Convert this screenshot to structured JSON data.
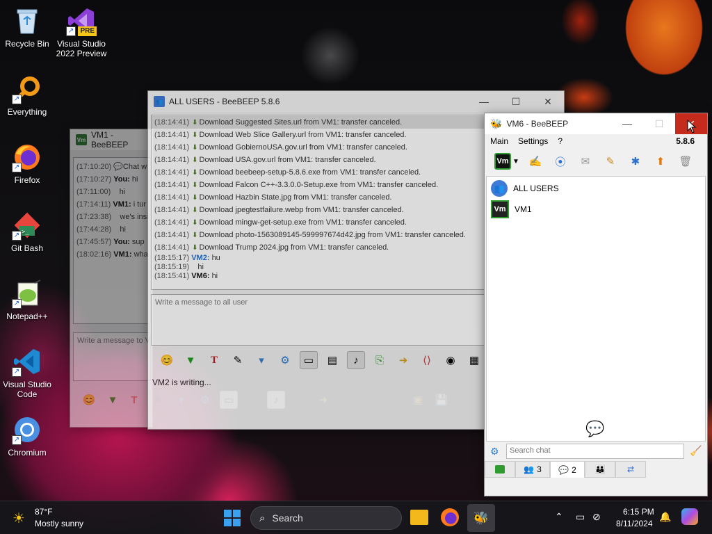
{
  "desktop": {
    "icons": [
      {
        "label": "Recycle Bin"
      },
      {
        "label": "Visual Studio 2022 Preview",
        "badge": "PRE"
      },
      {
        "label": "Everything"
      },
      {
        "label": "Firefox"
      },
      {
        "label": "Git Bash"
      },
      {
        "label": "Notepad++"
      },
      {
        "label": "Visual Studio Code"
      },
      {
        "label": "Chromium"
      }
    ]
  },
  "vm1_window": {
    "icon_text": "Vm",
    "title": "VM1 - BeeBEEP",
    "lines": [
      {
        "ts": "(17:10:20)",
        "name": "",
        "text": "Chat w"
      },
      {
        "ts": "(17:10:27)",
        "name": "You:",
        "text": "hi"
      },
      {
        "ts": "(17:11:00)",
        "name": "",
        "text": "hi"
      },
      {
        "ts": "(17:14:11)",
        "name": "VM1:",
        "text": "i tur"
      },
      {
        "ts": "(17:23:38)",
        "name": "",
        "text": "we's insi"
      },
      {
        "ts": "(17:44:28)",
        "name": "",
        "text": "hi"
      },
      {
        "ts": "(17:45:57)",
        "name": "You:",
        "text": "sup"
      },
      {
        "ts": "(18:02:16)",
        "name": "VM1:",
        "text": "wha"
      }
    ],
    "input_placeholder": "Write a message to VM"
  },
  "all_users_window": {
    "title": "ALL USERS - BeeBEEP 5.8.6",
    "log": [
      {
        "ts": "(18:14:41)",
        "text": "Download Suggested Sites.url from VM1: transfer canceled."
      },
      {
        "ts": "(18:14:41)",
        "text": "Download Web Slice Gallery.url from VM1: transfer canceled."
      },
      {
        "ts": "(18:14:41)",
        "text": "Download GobiernoUSA.gov.url from VM1: transfer canceled."
      },
      {
        "ts": "(18:14:41)",
        "text": "Download USA.gov.url from VM1: transfer canceled."
      },
      {
        "ts": "(18:14:41)",
        "text": "Download beebeep-setup-5.8.6.exe from VM1: transfer canceled."
      },
      {
        "ts": "(18:14:41)",
        "text": "Download Falcon C++-3.3.0.0-Setup.exe from VM1: transfer canceled."
      },
      {
        "ts": "(18:14:41)",
        "text": "Download Hazbin State.jpg from VM1: transfer canceled."
      },
      {
        "ts": "(18:14:41)",
        "text": "Download jpegtestfailure.webp from VM1: transfer canceled."
      },
      {
        "ts": "(18:14:41)",
        "text": "Download mingw-get-setup.exe from VM1: transfer canceled."
      },
      {
        "ts": "(18:14:41)",
        "text": "Download photo-1563089145-599997674d42.jpg from VM1: transfer canceled."
      },
      {
        "ts": "(18:14:41)",
        "text": "Download Trump 2024.jpg from VM1: transfer canceled."
      }
    ],
    "messages": [
      {
        "ts": "(18:15:17)",
        "name": "VM2:",
        "text": "hu"
      },
      {
        "ts": "(18:15:19)",
        "name": "",
        "text": "hi"
      },
      {
        "ts": "(18:15:41)",
        "name": "VM6:",
        "text": "hi"
      }
    ],
    "input_placeholder": "Write a message to all user",
    "status": "VM2 is writing..."
  },
  "vm6_window": {
    "title": "VM6 - BeeBEEP",
    "version": "5.8.6",
    "menu": [
      "Main",
      "Settings",
      "?"
    ],
    "users": [
      {
        "name": "ALL USERS",
        "icon": "group-icon"
      },
      {
        "name": "VM1",
        "icon_text": "Vm"
      }
    ],
    "search_placeholder": "Search chat",
    "tabs": [
      {
        "label": "",
        "icon": "chat-green-icon"
      },
      {
        "label": "3",
        "icon": "users-icon"
      },
      {
        "label": "2",
        "icon": "chat-bubbles-icon"
      },
      {
        "label": "",
        "icon": "groups-icon"
      },
      {
        "label": "",
        "icon": "share-icon"
      }
    ]
  },
  "taskbar": {
    "weather_temp": "87°F",
    "weather_desc": "Mostly sunny",
    "search_label": "Search",
    "time": "6:15 PM",
    "date": "8/11/2024"
  }
}
